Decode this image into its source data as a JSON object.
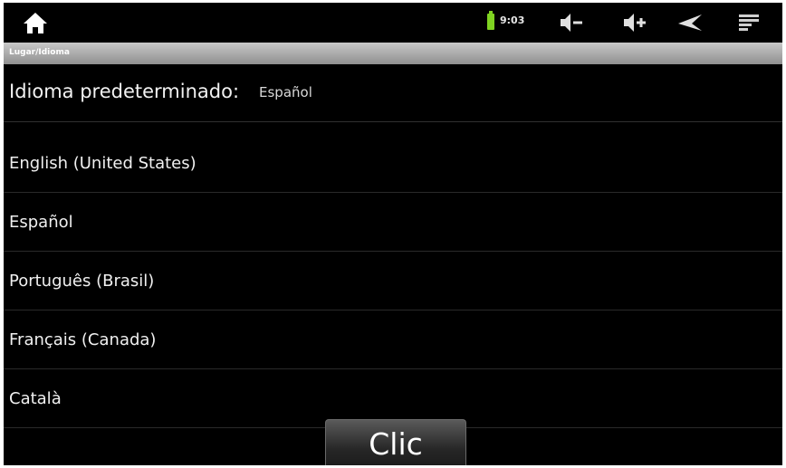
{
  "status_bar": {
    "time": "9:03",
    "battery_color": "#7fd321",
    "icons": [
      "home-icon",
      "volume-down-icon",
      "volume-up-icon",
      "back-icon",
      "menu-icon"
    ]
  },
  "title_bar": {
    "title": "Lugar/Idioma"
  },
  "current_language": {
    "label": "Idioma predeterminado:",
    "value": "Español"
  },
  "languages": [
    {
      "label": "English (United States)"
    },
    {
      "label": "Español"
    },
    {
      "label": "Português (Brasil)"
    },
    {
      "label": "Français (Canada)"
    },
    {
      "label": "Català"
    }
  ],
  "action_button": {
    "label": "Clic"
  }
}
